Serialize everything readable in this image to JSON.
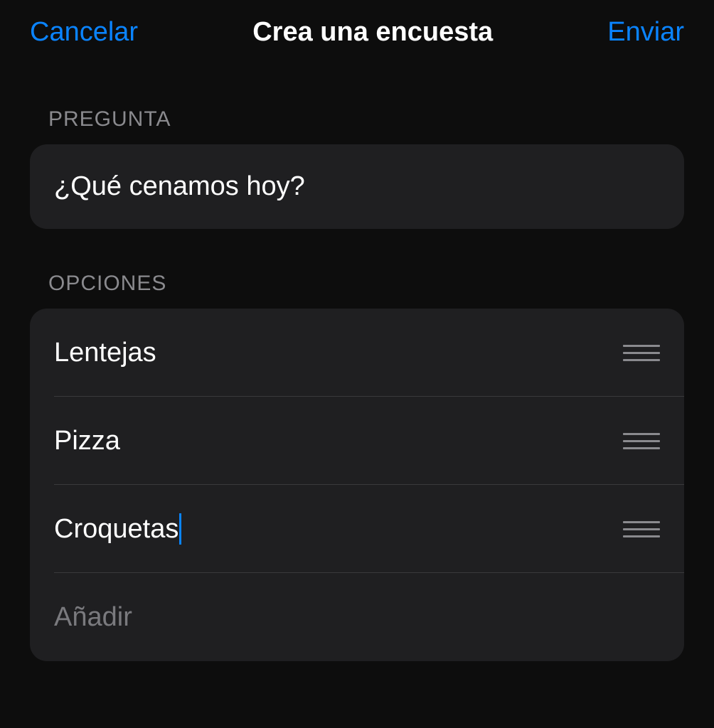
{
  "header": {
    "cancel_label": "Cancelar",
    "title": "Crea una encuesta",
    "send_label": "Enviar"
  },
  "question": {
    "section_label": "PREGUNTA",
    "value": "¿Qué cenamos hoy?"
  },
  "options": {
    "section_label": "OPCIONES",
    "items": [
      {
        "value": "Lentejas"
      },
      {
        "value": "Pizza"
      },
      {
        "value": "Croquetas"
      }
    ],
    "add_placeholder": "Añadir"
  }
}
